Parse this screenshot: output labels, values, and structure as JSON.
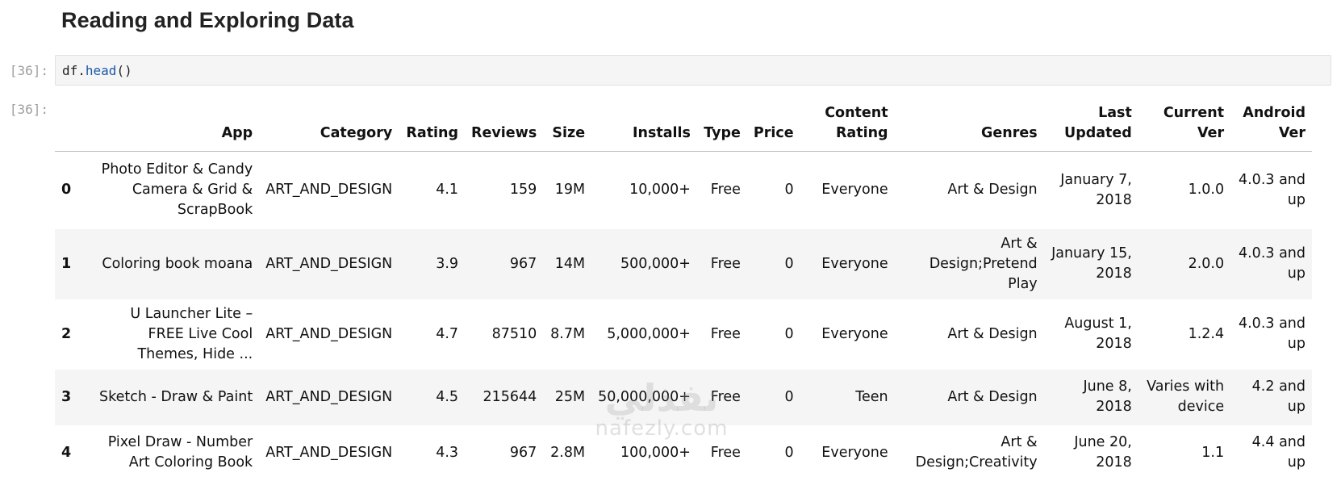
{
  "notebook": {
    "heading": "Reading and Exploring Data",
    "input_prompt": "[36]:",
    "output_prompt": "[36]:",
    "code": {
      "object": "df",
      "dot": ".",
      "function": "head",
      "parens": "()"
    }
  },
  "table": {
    "columns": [
      "App",
      "Category",
      "Rating",
      "Reviews",
      "Size",
      "Installs",
      "Type",
      "Price",
      "Content Rating",
      "Genres",
      "Last Updated",
      "Current Ver",
      "Android Ver"
    ],
    "rows": [
      {
        "index": "0",
        "cells": [
          "Photo Editor & Candy Camera & Grid & ScrapBook",
          "ART_AND_DESIGN",
          "4.1",
          "159",
          "19M",
          "10,000+",
          "Free",
          "0",
          "Everyone",
          "Art & Design",
          "January 7, 2018",
          "1.0.0",
          "4.0.3 and up"
        ]
      },
      {
        "index": "1",
        "cells": [
          "Coloring book moana",
          "ART_AND_DESIGN",
          "3.9",
          "967",
          "14M",
          "500,000+",
          "Free",
          "0",
          "Everyone",
          "Art & Design;Pretend Play",
          "January 15, 2018",
          "2.0.0",
          "4.0.3 and up"
        ]
      },
      {
        "index": "2",
        "cells": [
          "U Launcher Lite – FREE Live Cool Themes, Hide ...",
          "ART_AND_DESIGN",
          "4.7",
          "87510",
          "8.7M",
          "5,000,000+",
          "Free",
          "0",
          "Everyone",
          "Art & Design",
          "August 1, 2018",
          "1.2.4",
          "4.0.3 and up"
        ]
      },
      {
        "index": "3",
        "cells": [
          "Sketch - Draw & Paint",
          "ART_AND_DESIGN",
          "4.5",
          "215644",
          "25M",
          "50,000,000+",
          "Free",
          "0",
          "Teen",
          "Art & Design",
          "June 8, 2018",
          "Varies with device",
          "4.2 and up"
        ]
      },
      {
        "index": "4",
        "cells": [
          "Pixel Draw - Number Art Coloring Book",
          "ART_AND_DESIGN",
          "4.3",
          "967",
          "2.8M",
          "100,000+",
          "Free",
          "0",
          "Everyone",
          "Art & Design;Creativity",
          "June 20, 2018",
          "1.1",
          "4.4 and up"
        ]
      }
    ]
  },
  "watermark": {
    "arabic": "نفذلي",
    "latin": "nafezly.com"
  }
}
